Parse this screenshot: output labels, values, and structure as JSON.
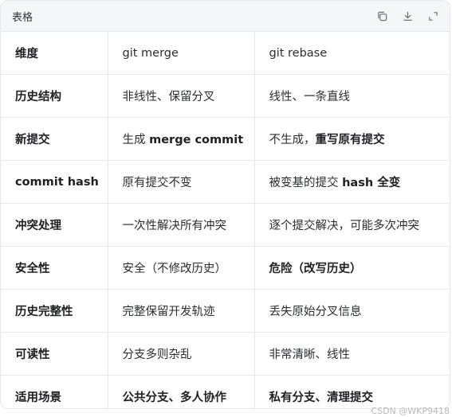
{
  "header": {
    "title": "表格",
    "icons": [
      "copy-icon",
      "download-icon",
      "expand-icon"
    ]
  },
  "table": {
    "rows": [
      {
        "c1": "维度",
        "c2a": "git merge",
        "c2b": "",
        "c3a": "git rebase",
        "c3b": ""
      },
      {
        "c1": "历史结构",
        "c2a": "非线性、保留分叉",
        "c2b": "",
        "c3a": "线性、一条直线",
        "c3b": ""
      },
      {
        "c1": "新提交",
        "c2a": "生成 ",
        "c2b": "merge commit",
        "c3a": "不生成，",
        "c3b": "重写原有提交"
      },
      {
        "c1": "commit hash",
        "c2a": "原有提交不变",
        "c2b": "",
        "c3a": "被变基的提交 ",
        "c3b": "hash 全变"
      },
      {
        "c1": "冲突处理",
        "c2a": "一次性解决所有冲突",
        "c2b": "",
        "c3a": "逐个提交解决，可能多次冲突",
        "c3b": ""
      },
      {
        "c1": "安全性",
        "c2a": "安全（不修改历史）",
        "c2b": "",
        "c3a": "",
        "c3b": "危险（改写历史）"
      },
      {
        "c1": "历史完整性",
        "c2a": "完整保留开发轨迹",
        "c2b": "",
        "c3a": "丢失原始分叉信息",
        "c3b": ""
      },
      {
        "c1": "可读性",
        "c2a": "分支多则杂乱",
        "c2b": "",
        "c3a": "非常清晰、线性",
        "c3b": ""
      },
      {
        "c1": "适用场景",
        "c2a": "",
        "c2b": "公共分支、多人协作",
        "c3a": "",
        "c3b": "私有分支、清理提交"
      }
    ]
  },
  "watermark": "CSDN @WKP9418"
}
